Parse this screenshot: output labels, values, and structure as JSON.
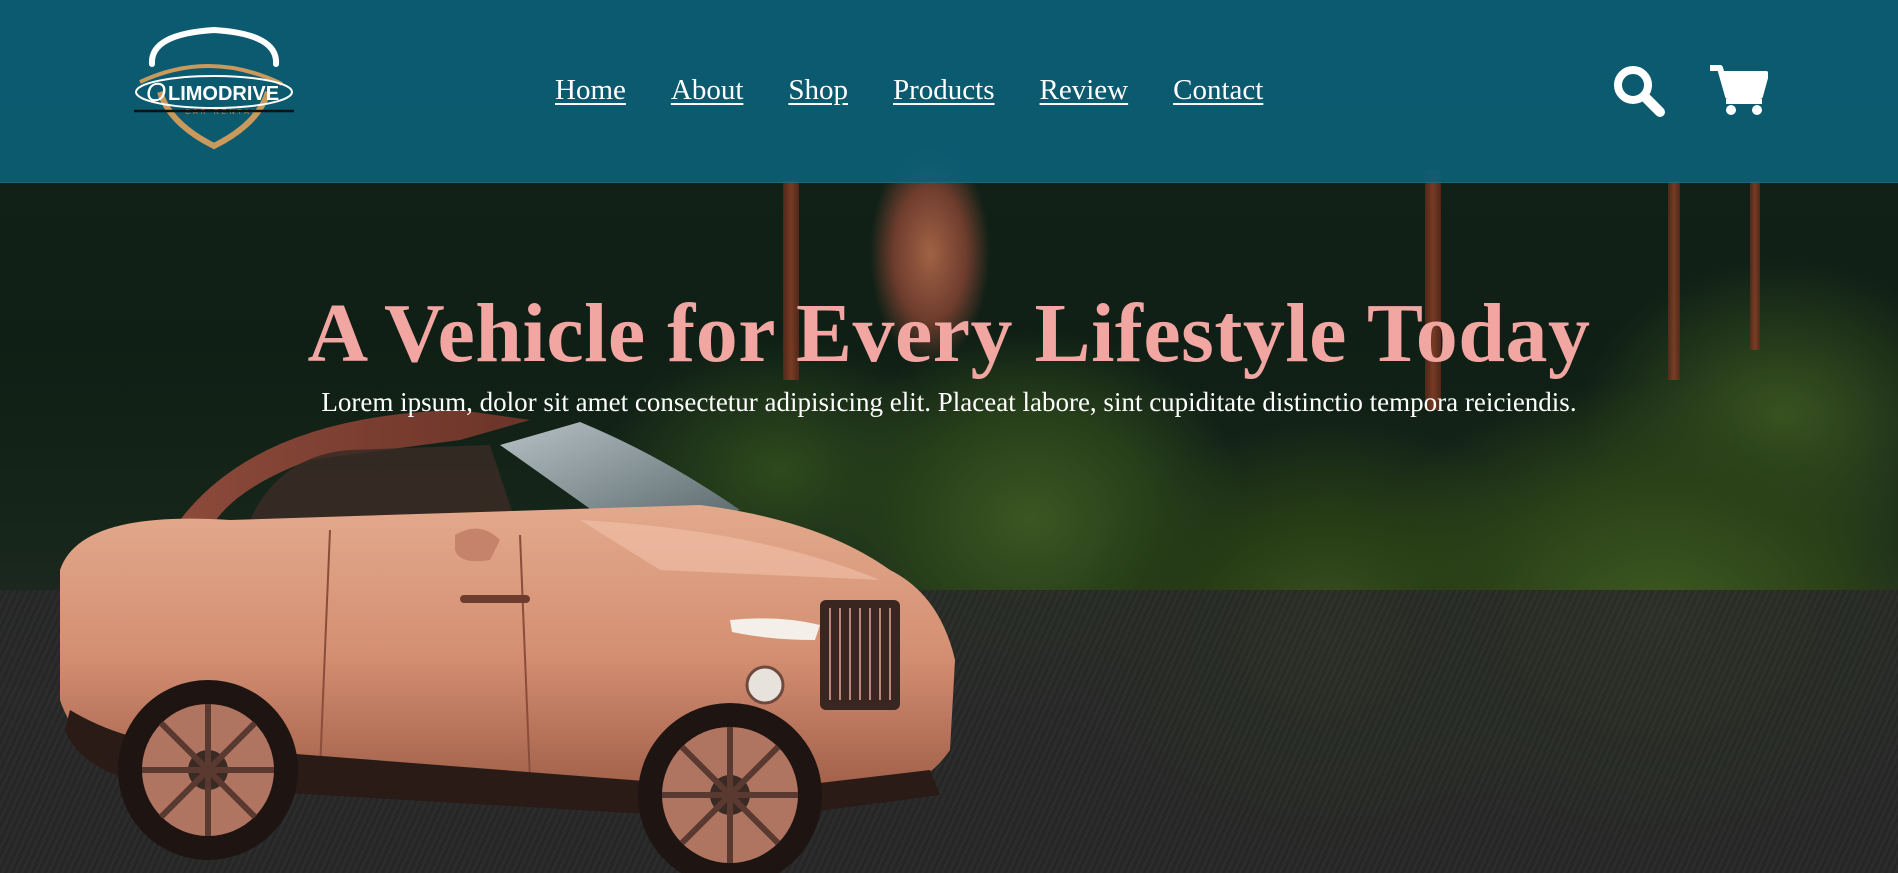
{
  "brand": {
    "logo_text": "LIMODRIVE",
    "logo_subtext": "CAR RENTAL"
  },
  "nav": {
    "links": [
      {
        "label": "Home"
      },
      {
        "label": "About"
      },
      {
        "label": "Shop"
      },
      {
        "label": "Products"
      },
      {
        "label": "Review"
      },
      {
        "label": "Contact"
      }
    ],
    "icons": [
      "search-icon",
      "shopping-cart-icon"
    ]
  },
  "hero": {
    "headline": "A Vehicle for Every Lifestyle Today",
    "subtext": "Lorem ipsum, dolor sit amet consectetur adipisicing elit. Placeat labore, sint cupiditate distinctio tempora reiciendis."
  },
  "colors": {
    "navbar_bg": "#0b5f76",
    "headline": "#f2a6a2",
    "nav_text": "#ffffff",
    "logo_gold": "#c99a5b"
  }
}
